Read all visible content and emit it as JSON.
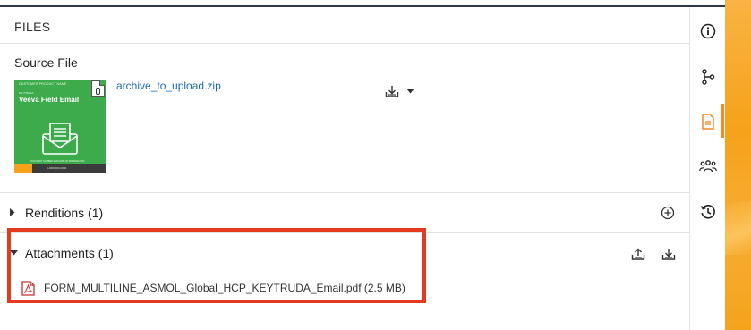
{
  "files": {
    "header": "FILES",
    "source_label": "Source File",
    "source_file_name": "archive_to_upload.zip",
    "thumbnail": {
      "brand": "CUSTOMER PRODUCT NAME",
      "sub": "KEYTRUDA",
      "product": "Veeva Field Email",
      "tiny": "DOCUMENT NUMBER AND DATE OF PREPARATION",
      "code": "A-0000000-0000"
    }
  },
  "renditions": {
    "title": "Renditions (1)"
  },
  "attachments": {
    "title": "Attachments (1)",
    "items": [
      {
        "name": "FORM_MULTILINE_ASMOL_Global_HCP_KEYTRUDA_Email.pdf (2.5 MB)"
      }
    ]
  },
  "rail": {
    "items": [
      "info-icon",
      "workflow-icon",
      "document-icon",
      "sharing-icon",
      "history-icon"
    ],
    "active": "document-icon"
  },
  "colors": {
    "accent": "#f08a24",
    "link": "#1a6bb3",
    "highlight": "#e53a1f",
    "thumbnail_green": "#3daa4b"
  }
}
